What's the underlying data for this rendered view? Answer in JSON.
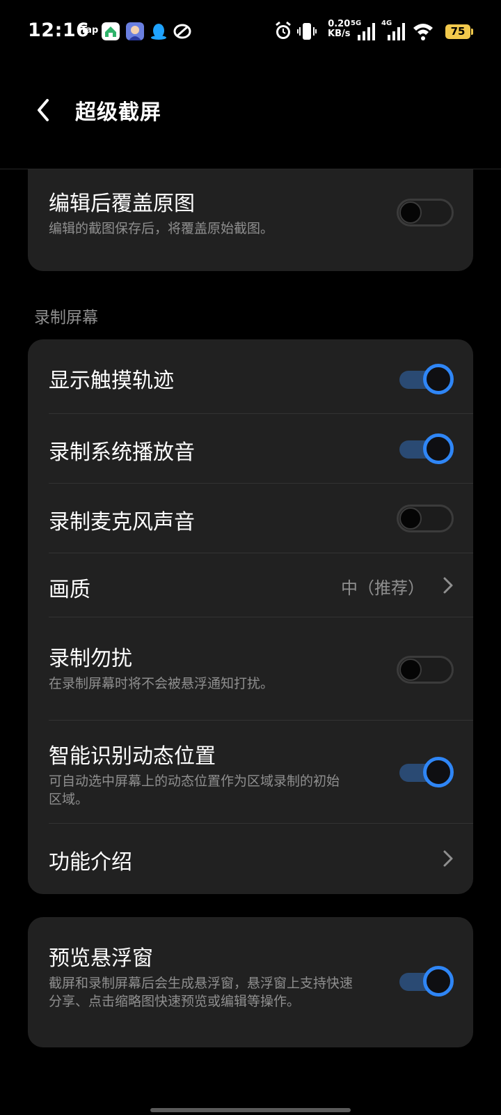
{
  "status_bar": {
    "time": "12:16",
    "tap_label": "Tap",
    "speed_value": "0.20",
    "speed_unit": "KB/s",
    "net1": "5G",
    "net2": "4G",
    "battery": "75",
    "colors": {
      "battery": "#f2c94c"
    },
    "icons": [
      "app-icon",
      "app-icon",
      "qq-icon",
      "app-icon",
      "alarm-icon",
      "vibrate-icon",
      "signal-icon",
      "signal-icon",
      "wifi-icon",
      "battery-icon"
    ]
  },
  "header": {
    "title": "超级截屏",
    "back_icon": "back-arrow-icon"
  },
  "card_top": {
    "overwrite": {
      "title": "编辑后覆盖原图",
      "desc": "编辑的截图保存后，将覆盖原始截图。",
      "toggle": false
    }
  },
  "section_record": {
    "label": "录制屏幕",
    "rows": {
      "touch": {
        "title": "显示触摸轨迹",
        "toggle": true
      },
      "system_audio": {
        "title": "录制系统播放音",
        "toggle": true
      },
      "mic": {
        "title": "录制麦克风声音",
        "toggle": false
      },
      "quality": {
        "title": "画质",
        "value": "中（推荐）"
      },
      "dnd": {
        "title": "录制勿扰",
        "desc": "在录制屏幕时将不会被悬浮通知打扰。",
        "toggle": false
      },
      "smart": {
        "title": "智能识别动态位置",
        "desc": "可自动选中屏幕上的动态位置作为区域录制的初始区域。",
        "toggle": true
      },
      "intro": {
        "title": "功能介绍"
      }
    }
  },
  "card_preview": {
    "title": "预览悬浮窗",
    "desc": "截屏和录制屏幕后会生成悬浮窗，悬浮窗上支持快速分享、点击缩略图快速预览或编辑等操作。",
    "toggle": true
  },
  "colors": {
    "background": "#000000",
    "card": "#212121",
    "accent": "#2f86f6",
    "secondary_text": "#8f8f8f"
  }
}
